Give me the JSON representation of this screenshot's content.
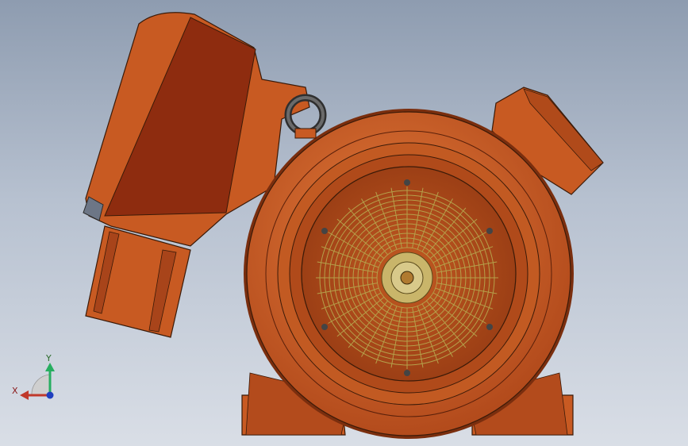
{
  "viewport": {
    "background_top": "#8e9cb0",
    "background_bottom": "#d9dee6",
    "part_color": "#d2652a",
    "part_shadow": "#a8441a",
    "cover_color": "#8a2a10",
    "fan_ring_color": "#b5a04a"
  },
  "triad": {
    "x_label": "X",
    "y_label": "Y",
    "x_color": "#c0392b",
    "y_color": "#27ae60",
    "z_color": "#1f3fbf"
  }
}
